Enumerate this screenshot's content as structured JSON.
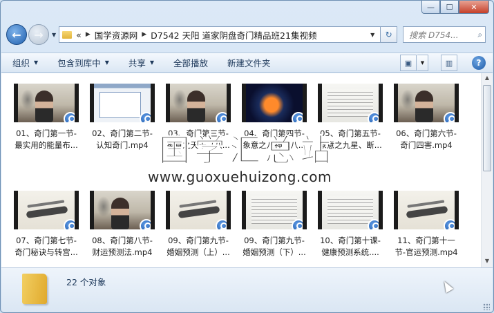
{
  "window": {
    "caption": {
      "minimize": "—",
      "maximize": "☐",
      "close": "✕"
    }
  },
  "navbar": {
    "back_icon": "arrow-left",
    "forward_icon": "arrow-right",
    "breadcrumb_lead": "«",
    "breadcrumbs": [
      "国学资源网",
      "D7542 天阳 道家阴盘奇门精品班21集视频"
    ],
    "refresh_icon": "↻",
    "search_placeholder": "搜索 D754..."
  },
  "cmdbar": {
    "items": [
      {
        "label": "组织",
        "dropdown": true
      },
      {
        "label": "包含到库中",
        "dropdown": true
      },
      {
        "label": "共享",
        "dropdown": true
      },
      {
        "label": "全部播放",
        "dropdown": false
      },
      {
        "label": "新建文件夹",
        "dropdown": false
      }
    ],
    "help": "?"
  },
  "files": [
    {
      "line1": "01、奇门第一节-",
      "line2": "最实用的能量布...",
      "thumb": "teacher"
    },
    {
      "line1": "02、奇门第二节-",
      "line2": "认知奇门.mp4",
      "thumb": "screen"
    },
    {
      "line1": "03、奇门第三节-",
      "line2": "象意之天干（八...",
      "thumb": "teacher"
    },
    {
      "line1": "04、奇门第四节-",
      "line2": "象意之八神（八...",
      "thumb": "taiji"
    },
    {
      "line1": "05、奇门第五节-",
      "line2": "象意之九星、断...",
      "thumb": "doc"
    },
    {
      "line1": "06、奇门第六节-",
      "line2": "奇门四害.mp4",
      "thumb": "teacher"
    },
    {
      "line1": "07、奇门第七节-",
      "line2": "奇门秘诀与转宫...",
      "thumb": "brush"
    },
    {
      "line1": "08、奇门第八节-",
      "line2": "财运预测法.mp4",
      "thumb": "teacher"
    },
    {
      "line1": "09、奇门第九节-",
      "line2": "婚姻预测（上）...",
      "thumb": "brush"
    },
    {
      "line1": "09、奇门第九节-",
      "line2": "婚姻预测（下）...",
      "thumb": "doc"
    },
    {
      "line1": "10、奇门第十课-",
      "line2": "健康预测系统....",
      "thumb": "doc"
    },
    {
      "line1": "11、奇门第十一",
      "line2": "节-官运预测.mp4",
      "thumb": "brush"
    }
  ],
  "watermark": {
    "cn": "国学汇总站",
    "url": "www.guoxuehuizong.com"
  },
  "details": {
    "count": "22 个对象"
  }
}
